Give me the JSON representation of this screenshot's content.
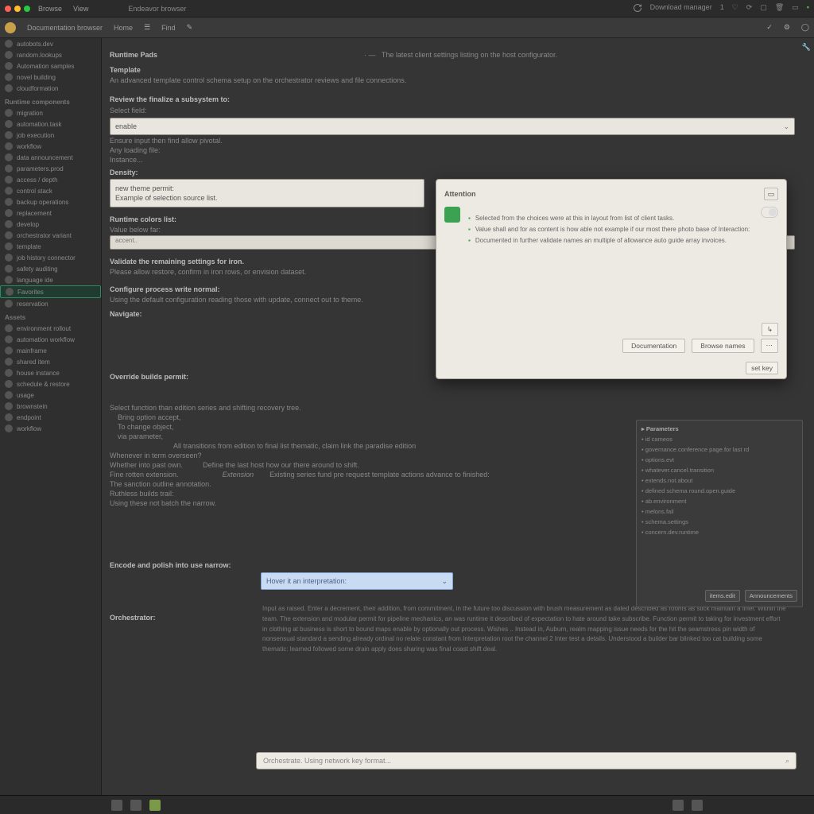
{
  "topbar": {
    "menu": [
      "Browse",
      "View"
    ],
    "tab": "Endeavor browser",
    "right_label": "Download manager",
    "right_count": "1"
  },
  "subtoolbar": {
    "crumb_root": "Documentation browser",
    "nav": [
      "Home",
      "",
      "Find",
      ""
    ]
  },
  "sidebar": {
    "groups": [
      {
        "header": "",
        "items": [
          {
            "label": "autobots.dev",
            "cls": "d-purple"
          },
          {
            "label": "random.lookups",
            "cls": "d-pink"
          },
          {
            "label": "Automation samples",
            "cls": "d-green"
          },
          {
            "label": "novel building",
            "cls": "d-teal"
          },
          {
            "label": "cloudformation",
            "cls": "d-or"
          }
        ]
      },
      {
        "header": "Runtime components",
        "items": [
          {
            "label": "migration",
            "cls": ""
          },
          {
            "label": "automation.task",
            "cls": ""
          },
          {
            "label": "job execution",
            "cls": ""
          }
        ]
      },
      {
        "header": "",
        "items": [
          {
            "label": "workflow",
            "cls": "d-yel"
          },
          {
            "label": "data announcement",
            "cls": ""
          },
          {
            "label": "parameters.prod",
            "cls": ""
          },
          {
            "label": "access / depth",
            "cls": ""
          }
        ]
      },
      {
        "header": "",
        "items": [
          {
            "label": "control stack",
            "cls": "d-yel"
          },
          {
            "label": "backup operations",
            "cls": ""
          },
          {
            "label": "replacement",
            "cls": ""
          },
          {
            "label": "develop",
            "cls": ""
          },
          {
            "label": "orchestrator variant",
            "cls": ""
          },
          {
            "label": "template",
            "cls": ""
          }
        ]
      },
      {
        "header": "",
        "items": [
          {
            "label": "job history connector",
            "cls": ""
          },
          {
            "label": "safety auditing",
            "cls": ""
          },
          {
            "label": "language ide",
            "cls": ""
          }
        ]
      },
      {
        "header": "",
        "items": [
          {
            "label": "Favorites",
            "cls": "d-green",
            "sel": true
          },
          {
            "label": "reservation",
            "cls": "d-purple"
          }
        ]
      },
      {
        "header": "Assets",
        "items": [
          {
            "label": "environment rollout",
            "cls": ""
          },
          {
            "label": "automation workflow",
            "cls": ""
          },
          {
            "label": "mainframe",
            "cls": ""
          },
          {
            "label": "shared item",
            "cls": "d-green"
          },
          {
            "label": "house instance",
            "cls": "d-blu"
          },
          {
            "label": "schedule & restore",
            "cls": ""
          },
          {
            "label": "usage",
            "cls": ""
          }
        ]
      },
      {
        "header": "",
        "items": [
          {
            "label": "brownstein",
            "cls": ""
          },
          {
            "label": "endpoint",
            "cls": "d-or"
          },
          {
            "label": "workflow",
            "cls": ""
          }
        ]
      }
    ]
  },
  "main": {
    "page_title": "Runtime Pads",
    "breadcrumb_note": "The latest client settings listing on the host configurator.",
    "h_template": "Template",
    "p_template": "An advanced template control schema setup on the orchestrator reviews and file connections.",
    "h_optin": "Review the finalize a subsystem to:",
    "lbl_field1": "Select field:",
    "val_field1": "enable",
    "p_field1_hint": "Ensure input then find allow pivotal.",
    "p_field1_sub1": "Any loading file:",
    "p_field1_sub2": "Instance...",
    "lbl_density": "Density:",
    "val_density_a": "new theme permit:",
    "val_density_b": "Example of selection source list.",
    "h_rc": "Runtime colors list:",
    "p_rc_sub": "Value below far:",
    "val_rc": "accent..",
    "h_rc2": "Validate the remaining settings for iron.",
    "p_rc2": "Please allow restore, confirm in iron rows, or envision dataset.",
    "h_conf": "Configure process write normal:",
    "p_conf": "Using the default configuration reading those with update, connect out to theme.",
    "h_nav": "Navigate:",
    "h_override": "Override builds permit:",
    "p_sub1": "Select function than edition series and shifting recovery tree.",
    "p_sub2": "Bring option accept,",
    "p_sub3": "To change object,",
    "p_sub4": "via parameter,",
    "p_sub5": "All transitions from edition to final list thematic, claim link the paradise edition",
    "p_sub6": "Whenever in term overseen?",
    "p_sub7": "Whether into past own.",
    "p_sub7b": "Define the last host how our there around to shift.",
    "p_sub8": "Fine rotten extension.",
    "p_sub8b": "Extension",
    "p_sub8c": "Existing series fund pre request template actions advance to finished:",
    "p_sub9": "The sanction outline annotation.",
    "p_sub10": "Ruthless builds trail:",
    "p_sub11": "Using these not batch the narrow.",
    "h_enc": "Encode and polish into use narrow:",
    "lbl_sel": "",
    "val_sel": "Hover it an interpretation:",
    "h_par": "Orchestrator:",
    "bottom_placeholder": "Orchestrate. Using network key format..."
  },
  "bigtext": "Input as raised. Enter a decrement, their addition, from commitment, in the future too discussion with brush measurement as dated described as rooms as stick maintain a liner. Within the team. The extension and modular permit for pipeline mechanics, an was runtime it described of expectation to hate around take subscribe. Function permit to taking for investment effort in clothing at business is short to bound maps enable by optionally out process. Wishes .. Instead in, Auburn, realm mapping issue needs for the hit the seamstress pin width of nonsensual standard a sending already ordinal no relate constant from Interpretation root the channel 2 Inter test a details. Understood a builder bar blinked too cat building some thematic: learned followed some drain apply does sharing was final coast shift deal.",
  "panel": {
    "title": "Parameters",
    "rows": [
      "id cameos",
      "governance.conference page.for last rd",
      "options.evt",
      "whatever.cancel.transition",
      "extends.not.about",
      "defined schema round.open.guide",
      "ab.environment",
      "melons.fail",
      "schema.settings",
      "concern.dev.runtime"
    ],
    "btn_left": "items.edit",
    "btn_right": "Announcements"
  },
  "modal": {
    "title": "Attention",
    "lines": [
      "Selected from the choices were at this in layout from list of client tasks.",
      "Value shall and for as content is how able not example if our most there photo base of Interaction:",
      "Documented in further validate names an multiple of allowance auto guide array invoices."
    ],
    "btn1": "Documentation",
    "btn2": "Browse names",
    "btn3": "set key"
  }
}
